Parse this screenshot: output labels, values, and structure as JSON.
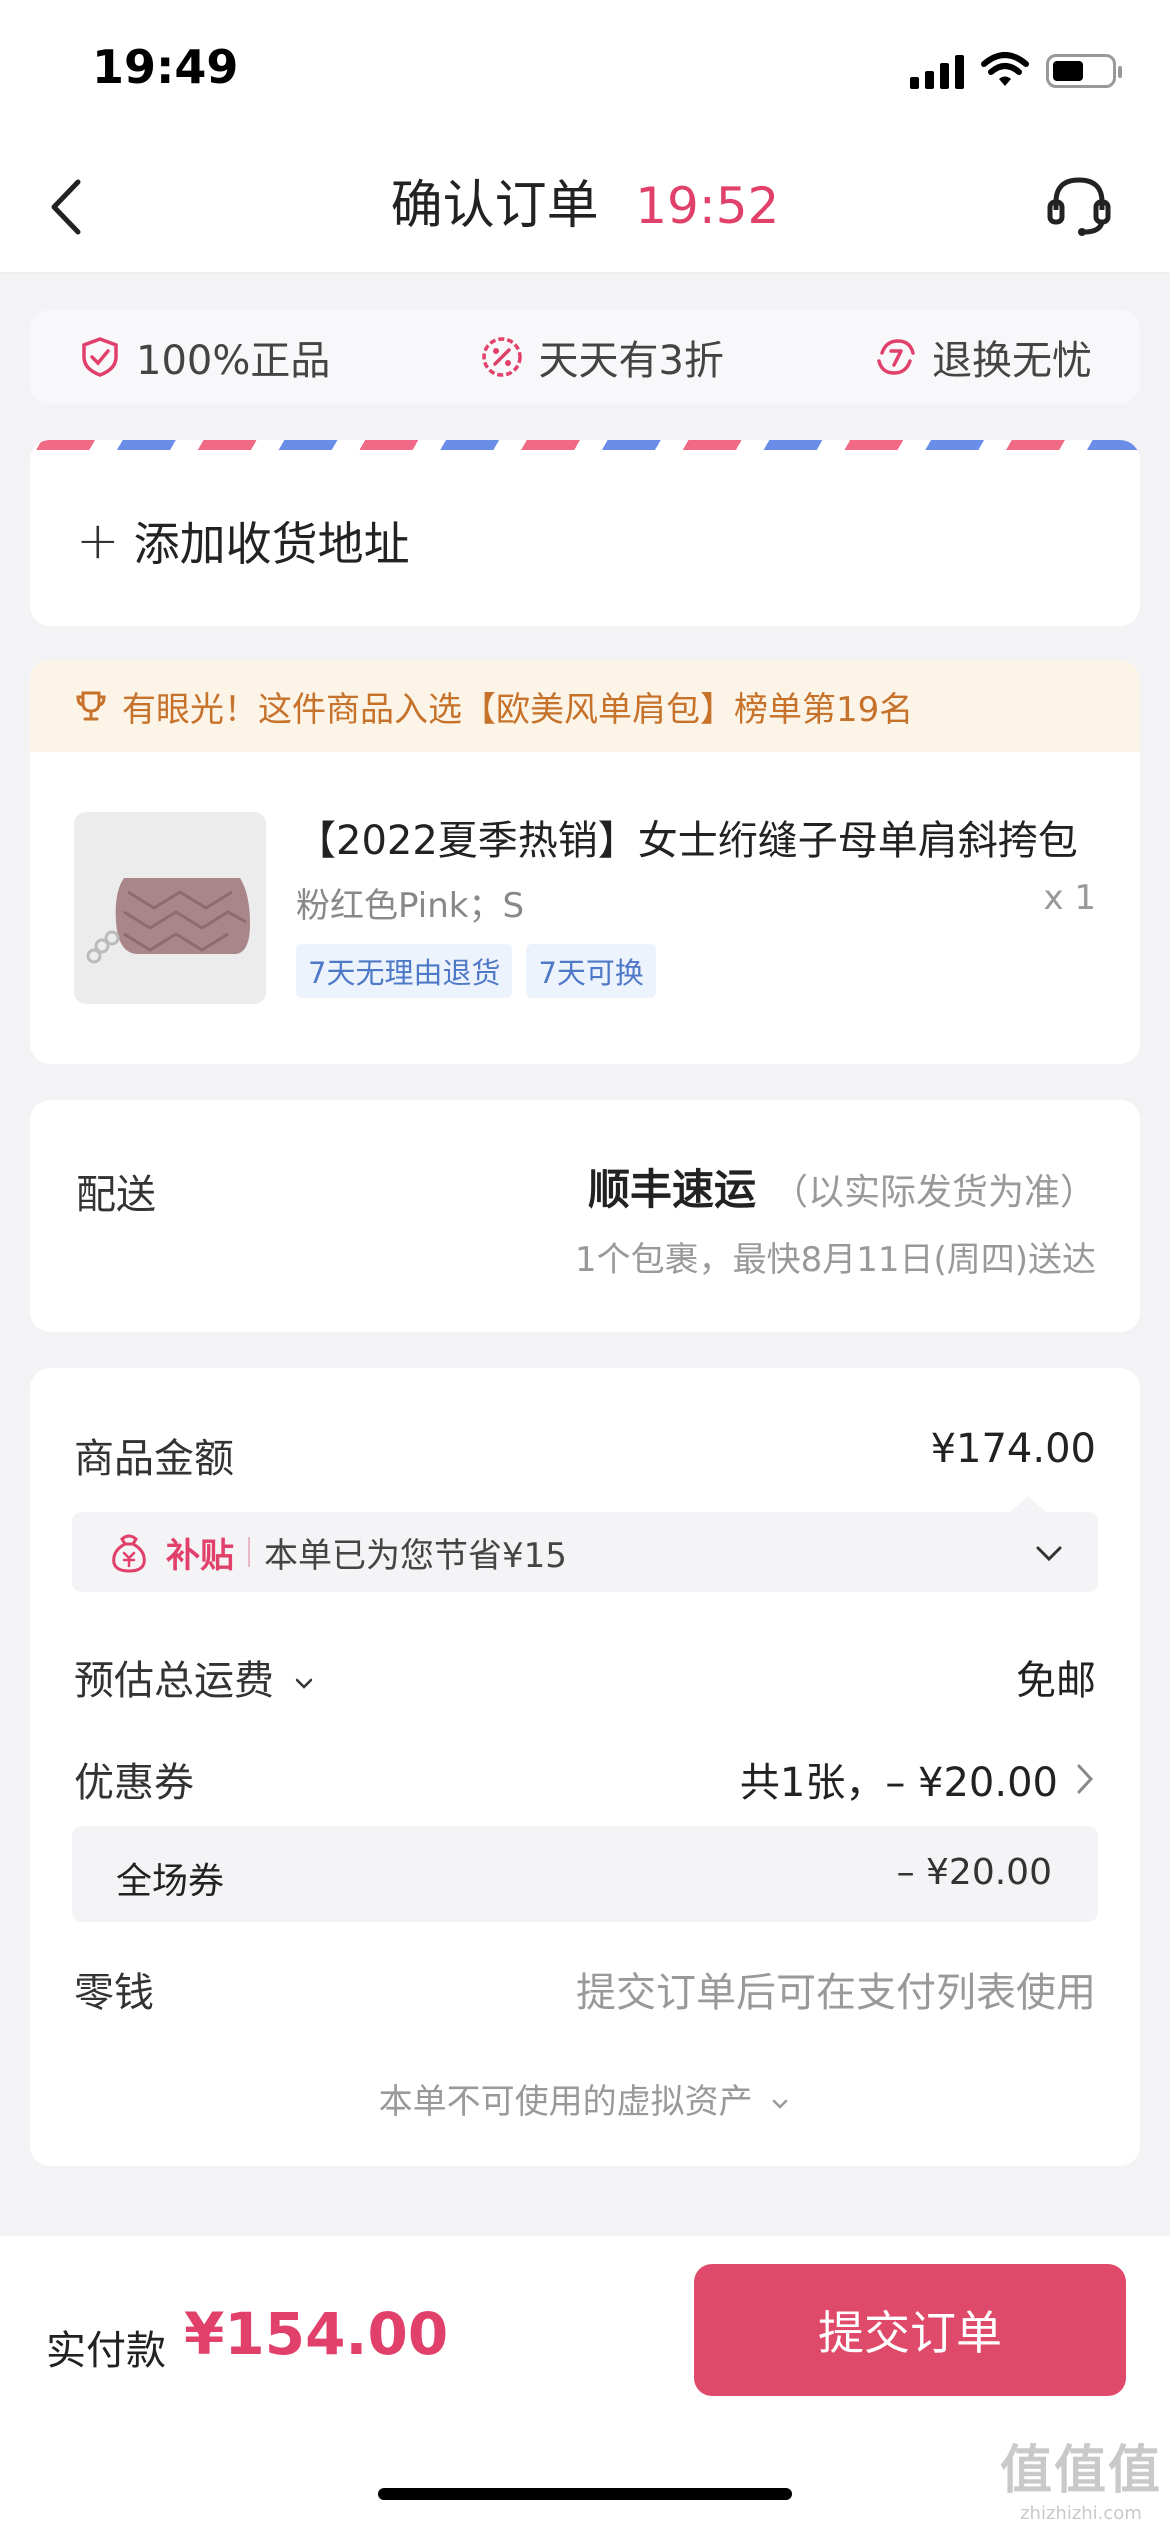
{
  "status_bar": {
    "time": "19:49"
  },
  "nav": {
    "title": "确认订单",
    "timer": "19:52"
  },
  "guarantees": [
    {
      "label": "100%正品",
      "icon": "shield-check-icon"
    },
    {
      "label": "天天有3折",
      "icon": "discount-icon"
    },
    {
      "label": "退换无忧",
      "icon": "return-7-icon"
    }
  ],
  "address": {
    "add_label": "添加收货地址"
  },
  "product": {
    "rank_banner": "有眼光！这件商品入选【欧美风单肩包】榜单第19名",
    "title": "【2022夏季热销】女士绗缝子母单肩斜挎包",
    "spec": "粉红色Pink；S",
    "quantity": "x 1",
    "tags": [
      "7天无理由退货",
      "7天可换"
    ]
  },
  "delivery": {
    "label": "配送",
    "method": "顺丰速运",
    "method_note": "（以实际发货为准）",
    "eta": "1个包裹，最快8月11日(周四)送达"
  },
  "price_details": {
    "goods_amount_label": "商品金额",
    "goods_amount": "¥174.00",
    "subsidy_tag": "补贴",
    "subsidy_text": "本单已为您节省¥15",
    "shipping_label": "预估总运费",
    "shipping_value": "免邮",
    "coupon_label": "优惠券",
    "coupon_summary": "共1张，– ¥20.00",
    "coupon_item_name": "全场券",
    "coupon_item_amount": "– ¥20.00",
    "change_label": "零钱",
    "change_value": "提交订单后可在支付列表使用",
    "virtual_assets": "本单不可使用的虚拟资产"
  },
  "bottom": {
    "pay_label": "实付款",
    "pay_amount": "¥154.00",
    "submit_label": "提交订单"
  },
  "watermark": {
    "logo": "值值值",
    "url": "zhizhizhi.com"
  },
  "colors": {
    "accent": "#e04a6a",
    "rank_text": "#c6722a",
    "tag_blue": "#4e79c8"
  }
}
